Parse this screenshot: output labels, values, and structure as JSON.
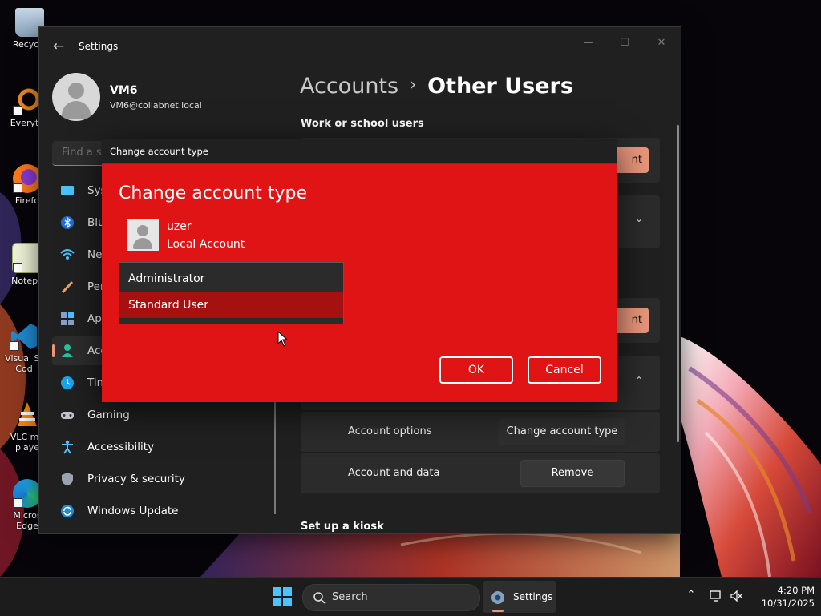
{
  "desktop": {
    "icons": [
      {
        "label": "Recycle",
        "icon": "recycle-bin-icon"
      },
      {
        "label": "Everyth",
        "icon": "everything-search-icon"
      },
      {
        "label": "Firefo",
        "icon": "firefox-icon"
      },
      {
        "label": "Notepa",
        "icon": "notepad-icon"
      },
      {
        "label": "Visual St Cod",
        "icon": "vscode-icon"
      },
      {
        "label": "VLC me playe",
        "icon": "vlc-icon"
      },
      {
        "label": "Micros Edge",
        "icon": "edge-icon"
      }
    ]
  },
  "settings": {
    "title": "Settings",
    "back_icon": "←",
    "controls": {
      "minimize": "—",
      "maximize": "☐",
      "close": "✕"
    },
    "profile": {
      "name": "VM6",
      "email": "VM6@collabnet.local"
    },
    "search_placeholder": "Find a se",
    "nav": [
      {
        "label": "Sys",
        "icon": "system-icon"
      },
      {
        "label": "Blu",
        "icon": "bluetooth-icon"
      },
      {
        "label": "Ne",
        "icon": "network-icon"
      },
      {
        "label": "Per",
        "icon": "personalization-icon"
      },
      {
        "label": "App",
        "icon": "apps-icon"
      },
      {
        "label": "Acc",
        "icon": "accounts-icon",
        "active": true
      },
      {
        "label": "Tim",
        "icon": "time-language-icon"
      },
      {
        "label": "Gaming",
        "icon": "gaming-icon"
      },
      {
        "label": "Accessibility",
        "icon": "accessibility-icon"
      },
      {
        "label": "Privacy & security",
        "icon": "privacy-shield-icon"
      },
      {
        "label": "Windows Update",
        "icon": "windows-update-icon"
      }
    ],
    "breadcrumb": {
      "parent": "Accounts",
      "separator": "›",
      "current": "Other Users"
    },
    "section_work": "Work or school users",
    "add_btn_fragment_1": "nt",
    "add_btn_fragment_2": "nt",
    "account_options_label": "Account options",
    "change_type_btn": "Change account type",
    "account_data_label": "Account and data",
    "remove_btn": "Remove",
    "section_kiosk": "Set up a kiosk"
  },
  "dialog": {
    "window_title": "Change account type",
    "heading": "Change account type",
    "user_name": "uzer",
    "user_type": "Local Account",
    "options": [
      "Administrator",
      "Standard User"
    ],
    "selected": "Standard User",
    "ok": "OK",
    "cancel": "Cancel"
  },
  "taskbar": {
    "search_label": "Search",
    "app_label": "Settings",
    "time": "4:20 PM",
    "date": "10/31/2025",
    "tray_icons": [
      "chevron-up-icon",
      "network-display-icon",
      "volume-muted-icon"
    ]
  },
  "colors": {
    "dialog_bg": "#e01414",
    "accent": "#e9967a",
    "window_bg": "#202020"
  }
}
